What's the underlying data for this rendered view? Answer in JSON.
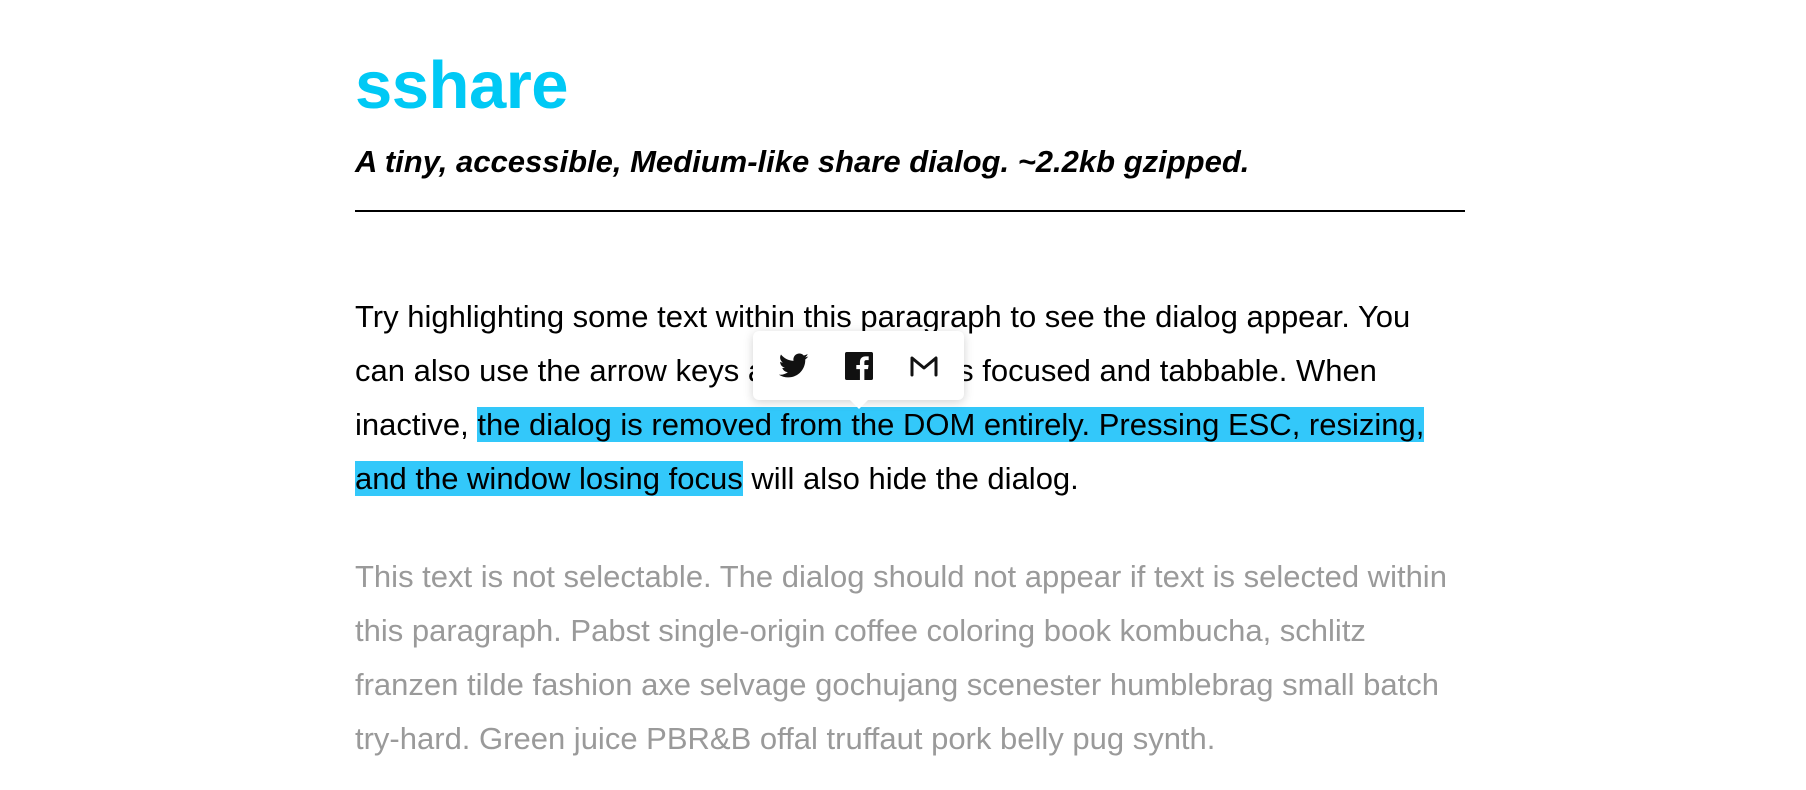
{
  "colors": {
    "accent": "#00c9f5",
    "selection": "#33c8fa",
    "muted_text": "#9a9a9a"
  },
  "header": {
    "title": "sshare",
    "subtitle": "A tiny, accessible, Medium-like share dialog. ~2.2kb gzipped."
  },
  "demo": {
    "text_before_selection": "Try highlighting some text within this paragraph to see the dialog appear. You can also use the arrow keys and the dialog is focused and tabbable. When inactive, ",
    "selected_text": "the dialog is removed from the DOM entirely. Pressing ESC, resizing, and the window losing focus",
    "text_after_selection": " will also hide the dialog."
  },
  "unselectable": {
    "text": "This text is not selectable. The dialog should not appear if text is selected within this paragraph. Pabst single-origin coffee coloring book kombucha, schlitz franzen tilde fashion axe selvage gochujang scenester humblebrag small batch try-hard. Green juice PBR&B offal truffaut pork belly pug synth."
  },
  "share_dialog": {
    "buttons": [
      {
        "icon": "twitter-icon"
      },
      {
        "icon": "facebook-icon"
      },
      {
        "icon": "gmail-icon"
      }
    ]
  }
}
